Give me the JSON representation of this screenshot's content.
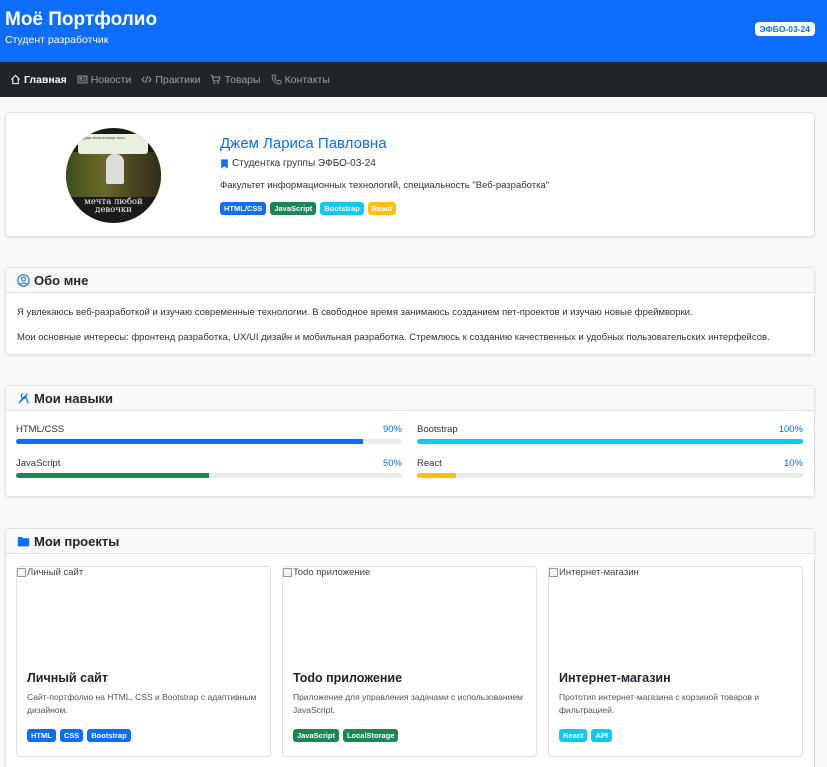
{
  "header": {
    "title": "Моё Портфолио",
    "subtitle": "Студент разработчик",
    "badge": "ЭФБО-03-24"
  },
  "nav": [
    {
      "label": "Главная",
      "icon": "home-icon",
      "active": true
    },
    {
      "label": "Новости",
      "icon": "newspaper-icon"
    },
    {
      "label": "Практики",
      "icon": "code-icon"
    },
    {
      "label": "Товары",
      "icon": "cart-icon"
    },
    {
      "label": "Контакты",
      "icon": "phone-icon"
    }
  ],
  "profile": {
    "name": "Джем Лариса Павловна",
    "group": "Студентка группы ЭФБО-03-24",
    "faculty": "Факультет информационных технологий, специальность \"Веб-разработка\"",
    "avatar_caption": "мечта любой\nдевочки",
    "avatar_top_text": "Бурда знаю кольце есть",
    "tags": [
      "HTML/CSS",
      "JavaScript",
      "Bootstrap",
      "React"
    ]
  },
  "about": {
    "title": "Обо мне",
    "p1": "Я увлекаюсь веб-разработкой и изучаю современные технологии. В свободное время занимаюсь созданием пет-проектов и изучаю новые фреймворки.",
    "p2": "Мои основные интересы: фронтенд разработка, UX/UI дизайн и мобильная разработка. Стремлюсь к созданию качественных и удобных пользовательских интерфейсов."
  },
  "skills": {
    "title": "Мои навыки",
    "items": [
      {
        "name": "HTML/CSS",
        "percent": "90%",
        "value": 0.9,
        "color": "#0d6efd"
      },
      {
        "name": "Bootstrap",
        "percent": "100%",
        "value": 1.0,
        "color": "#0dcaf0"
      },
      {
        "name": "JavaScript",
        "percent": "50%",
        "value": 0.5,
        "color": "#198754"
      },
      {
        "name": "React",
        "percent": "10%",
        "value": 0.1,
        "color": "#ffc107"
      }
    ]
  },
  "projects": {
    "title": "Мои проекты",
    "items": [
      {
        "img_alt": "Личный сайт",
        "title": "Личный сайт",
        "desc": "Сайт-портфолио на HTML, CSS и Bootstrap с адаптивным дизайном.",
        "tags": [
          "HTML",
          "CSS",
          "Bootstrap"
        ]
      },
      {
        "img_alt": "Todo приложение",
        "title": "Todo приложение",
        "desc": "Приложение для управления задачами с использованием JavaScript.",
        "tags": [
          "JavaScript",
          "LocalStorage"
        ]
      },
      {
        "img_alt": "Интернет-магазин",
        "title": "Интернет-магазин",
        "desc": "Прототип интернет-магазина с корзиной товаров и фильтрацией.",
        "tags": [
          "React",
          "API"
        ]
      }
    ]
  },
  "colors": {
    "primary": "#0d6efd",
    "success": "#198754",
    "info": "#0dcaf0",
    "warning": "#ffc107",
    "dark": "#212529"
  }
}
